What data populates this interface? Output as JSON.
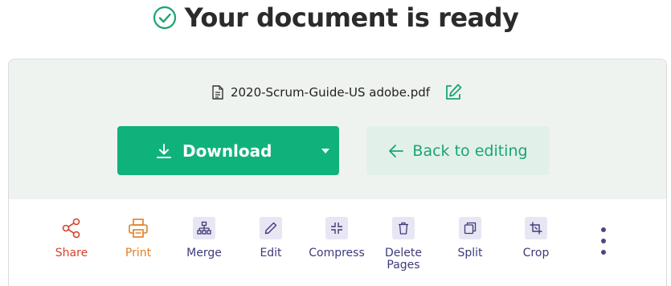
{
  "header": {
    "title": "Your document is ready"
  },
  "file": {
    "name": "2020-Scrum-Guide-US adobe.pdf"
  },
  "actions": {
    "download_label": "Download",
    "back_label": "Back to editing"
  },
  "tools": [
    {
      "label": "Share",
      "icon": "share-icon"
    },
    {
      "label": "Print",
      "icon": "print-icon"
    },
    {
      "label": "Merge",
      "icon": "merge-icon"
    },
    {
      "label": "Edit",
      "icon": "edit-icon"
    },
    {
      "label": "Compress",
      "icon": "compress-icon"
    },
    {
      "label": "Delete Pages",
      "icon": "trash-icon"
    },
    {
      "label": "Split",
      "icon": "split-icon"
    },
    {
      "label": "Crop",
      "icon": "crop-icon"
    }
  ],
  "more": {
    "icon": "more-vertical-icon"
  },
  "colors": {
    "primary_green": "#10b27b",
    "secondary_green_bg": "#e1f1ea",
    "share_red": "#d4432b",
    "print_orange": "#e07f22",
    "tool_purple": "#3d3a7a"
  }
}
